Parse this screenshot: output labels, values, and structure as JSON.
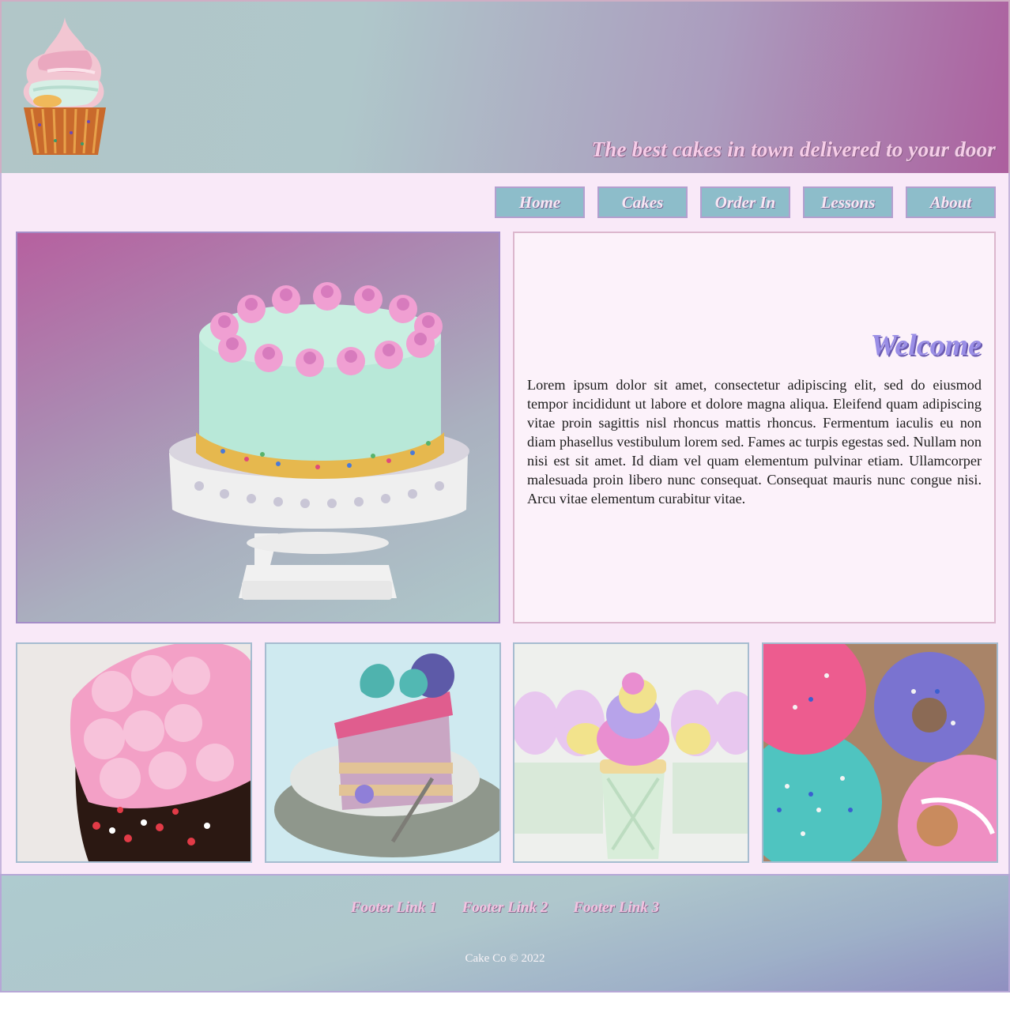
{
  "header": {
    "logo_icon": "cupcake-logo-icon",
    "tagline": "The best cakes in town delivered to your door"
  },
  "nav": {
    "items": [
      {
        "label": "Home"
      },
      {
        "label": "Cakes"
      },
      {
        "label": "Order In"
      },
      {
        "label": "Lessons"
      },
      {
        "label": "About"
      }
    ]
  },
  "hero": {
    "image": "layered-cake-on-stand"
  },
  "welcome": {
    "title": "Welcome",
    "text": "Lorem ipsum dolor sit amet, consectetur adipiscing elit, sed do eiusmod tempor incididunt ut labore et dolore magna aliqua. Eleifend quam adipiscing vitae proin sagittis nisl rhoncus mattis rhoncus. Fermentum iaculis eu non diam phasellus vestibulum lorem sed. Fames ac turpis egestas sed. Nullam non nisi est sit amet. Id diam vel quam elementum pulvinar etiam. Ullamcorper malesuada proin libero nunc consequat. Consequat mauris nunc congue nisi. Arcu vitae elementum curabitur vitae."
  },
  "gallery": {
    "images": [
      "frosted-ring-cake",
      "cake-slice-with-macaron",
      "pastel-cupcakes",
      "sprinkled-donuts"
    ]
  },
  "footer": {
    "links": [
      {
        "label": "Footer Link 1"
      },
      {
        "label": "Footer Link 2"
      },
      {
        "label": "Footer Link 3"
      }
    ],
    "copyright": "Cake Co © 2022"
  },
  "colors": {
    "accent": "#8dbdca",
    "brand_pink": "#ac5f9e",
    "welcome_purple": "#9a8ee6",
    "page_background": "#f9e9f8"
  }
}
